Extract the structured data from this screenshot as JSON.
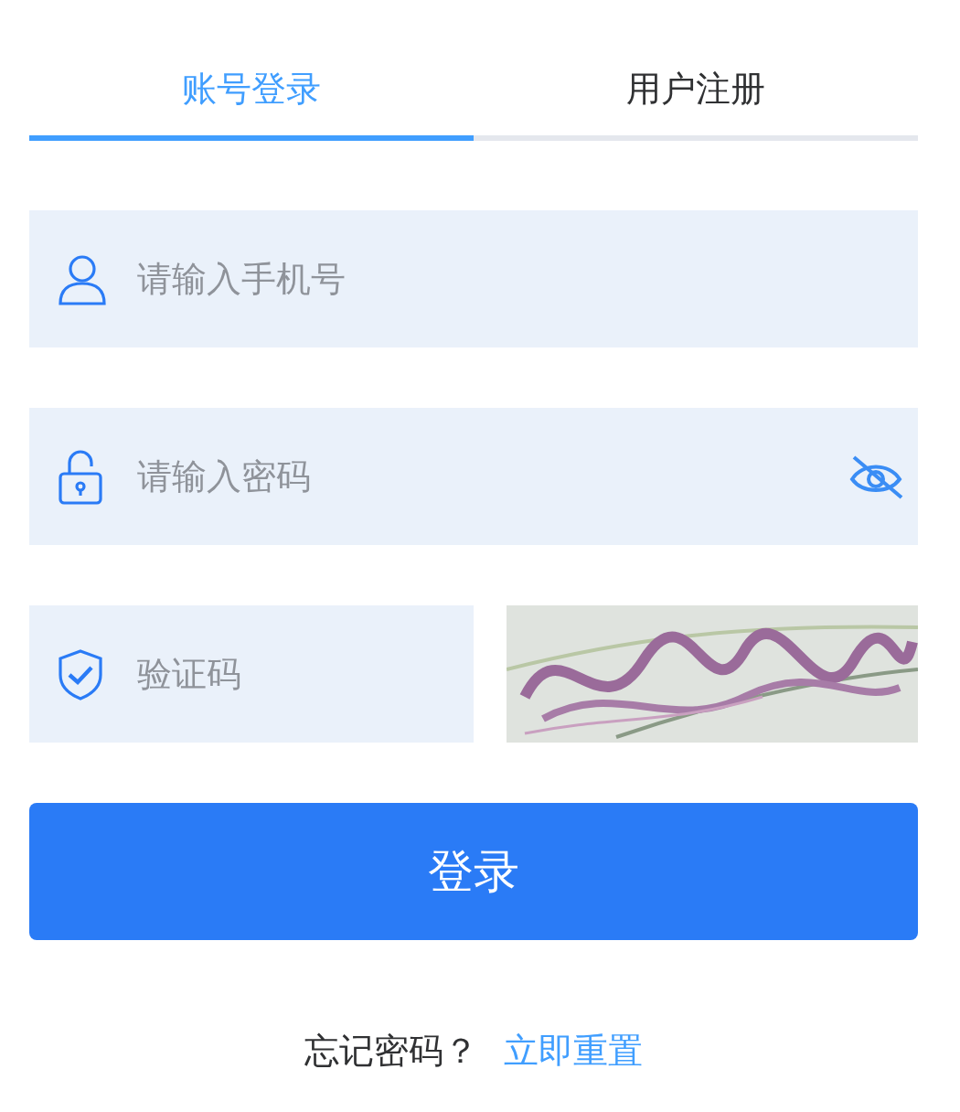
{
  "tabs": [
    {
      "label": "账号登录",
      "selected": true
    },
    {
      "label": "用户注册",
      "selected": false
    }
  ],
  "fields": [
    {
      "kind": "phone",
      "placeholder": "请输入手机号"
    },
    {
      "kind": "password",
      "placeholder": "请输入密码"
    },
    {
      "kind": "captcha",
      "placeholder": "验证码"
    }
  ],
  "submit_button": "登录",
  "footer": {
    "text": "忘记密码？",
    "link": "立即重置"
  }
}
